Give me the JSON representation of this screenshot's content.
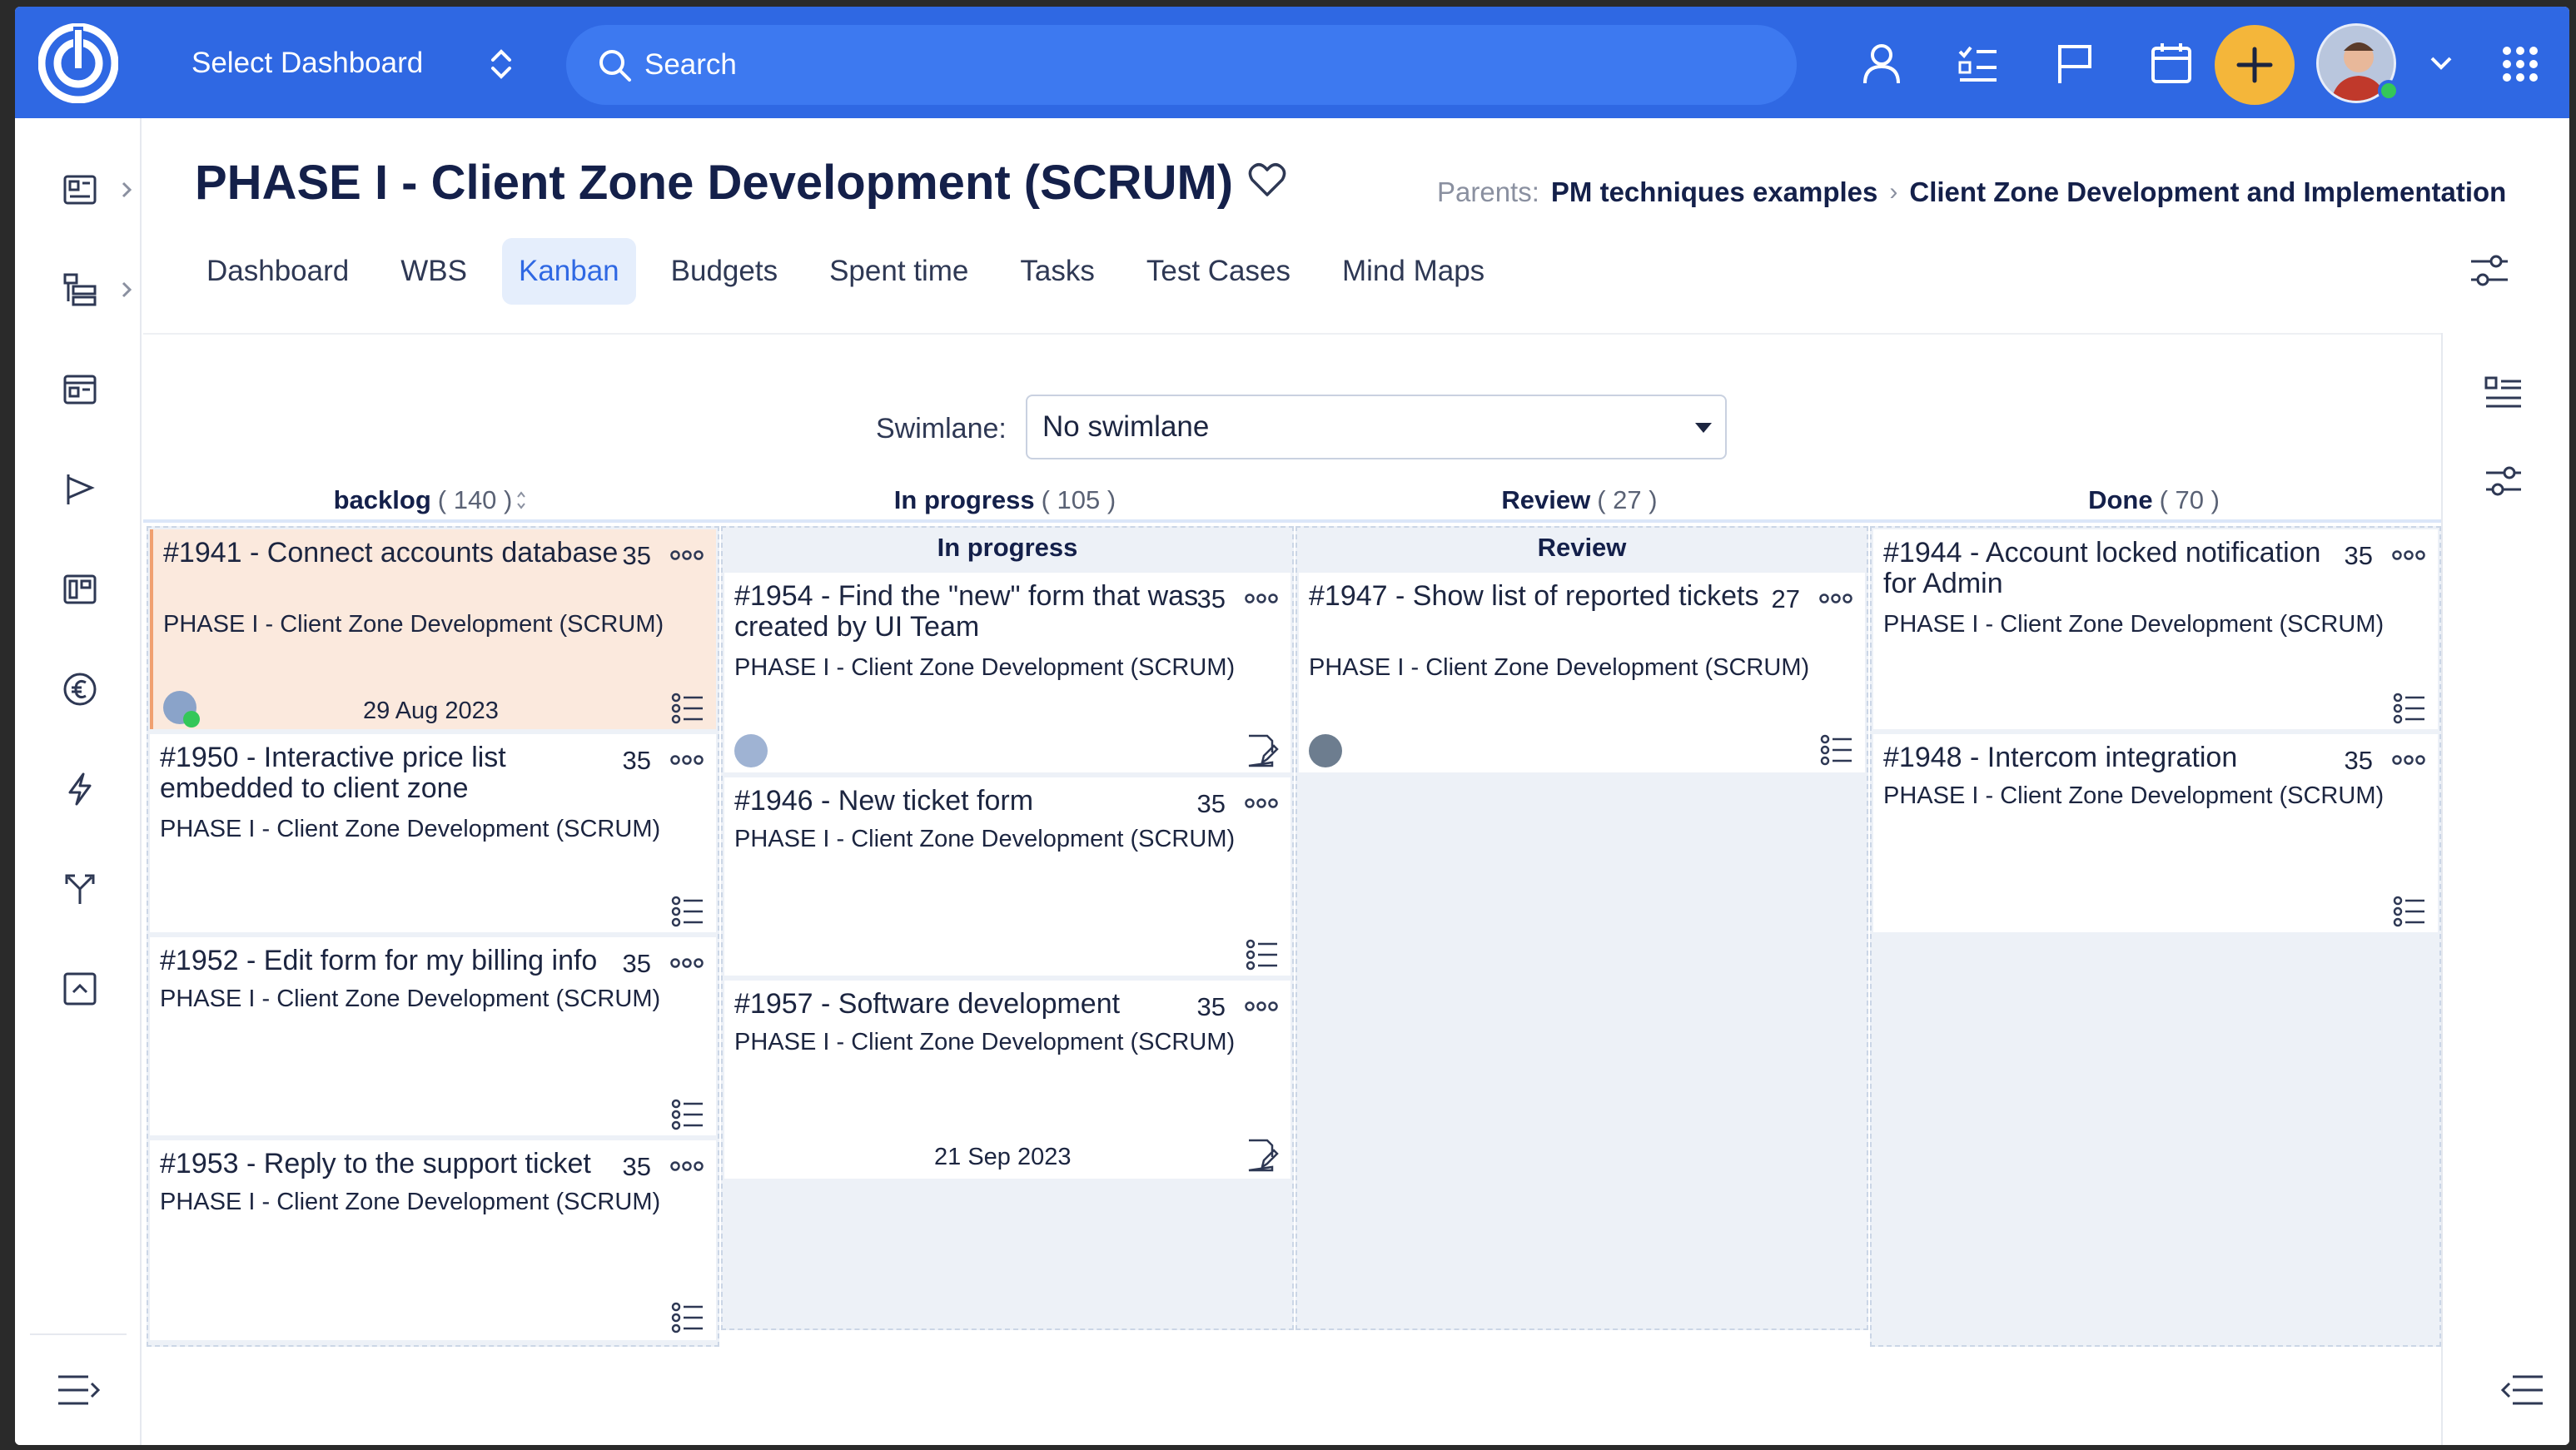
{
  "topbar": {
    "select_dashboard": "Select Dashboard",
    "search_placeholder": "Search"
  },
  "header": {
    "title": "PHASE I - Client Zone Development (SCRUM)",
    "parents_label": "Parents:",
    "parents": [
      "PM techniques examples",
      "Client Zone Development and Implementation"
    ],
    "breadcrumb_sep": "›"
  },
  "tabs": [
    "Dashboard",
    "WBS",
    "Kanban",
    "Budgets",
    "Spent time",
    "Tasks",
    "Test Cases",
    "Mind Maps"
  ],
  "active_tab": "Kanban",
  "board": {
    "swimlane_label": "Swimlane:",
    "swimlane_value": "No swimlane",
    "columns": [
      {
        "name": "backlog",
        "count": "( 140 )"
      },
      {
        "name": "In progress",
        "count": "( 105 )",
        "inner_title": "In progress"
      },
      {
        "name": "Review",
        "count": "( 27 )",
        "inner_title": "Review"
      },
      {
        "name": "Done",
        "count": "( 70 )"
      }
    ],
    "cards": {
      "backlog": [
        {
          "title": "#1941 - Connect accounts database",
          "points": "35",
          "project": "PHASE I - Client Zone Development (SCRUM)",
          "date": "29 Aug 2023"
        },
        {
          "title": "#1950 - Interactive price list embedded to client zone",
          "points": "35",
          "project": "PHASE I - Client Zone Development (SCRUM)"
        },
        {
          "title": "#1952 - Edit form for my billing info",
          "points": "35",
          "project": "PHASE I - Client Zone Development (SCRUM)"
        },
        {
          "title": "#1953 - Reply to the support ticket",
          "points": "35",
          "project": "PHASE I - Client Zone Development (SCRUM)"
        }
      ],
      "in_progress": [
        {
          "title": "#1954 - Find the \"new\" form that was created by UI Team",
          "points": "35",
          "project": "PHASE I - Client Zone Development (SCRUM)"
        },
        {
          "title": "#1946 - New ticket form",
          "points": "35",
          "project": "PHASE I - Client Zone Development (SCRUM)"
        },
        {
          "title": "#1957 - Software development",
          "points": "35",
          "project": "PHASE I - Client Zone Development (SCRUM)",
          "date": "21 Sep 2023"
        }
      ],
      "review": [
        {
          "title": "#1947 - Show list of reported tickets",
          "points": "27",
          "project": "PHASE I - Client Zone Development (SCRUM)"
        }
      ],
      "done": [
        {
          "title": "#1944 - Account locked notification for Admin",
          "points": "35",
          "project": "PHASE I - Client Zone Development (SCRUM)"
        },
        {
          "title": "#1948 - Intercom integration",
          "points": "35",
          "project": "PHASE I - Client Zone Development (SCRUM)"
        }
      ]
    }
  },
  "colors": {
    "topbar": "#2f68e3",
    "accent": "#f4b63a",
    "active_tab_bg": "#e5eefc",
    "column_bg": "#edf1f7",
    "highlight_card": "#fbe9dd"
  }
}
